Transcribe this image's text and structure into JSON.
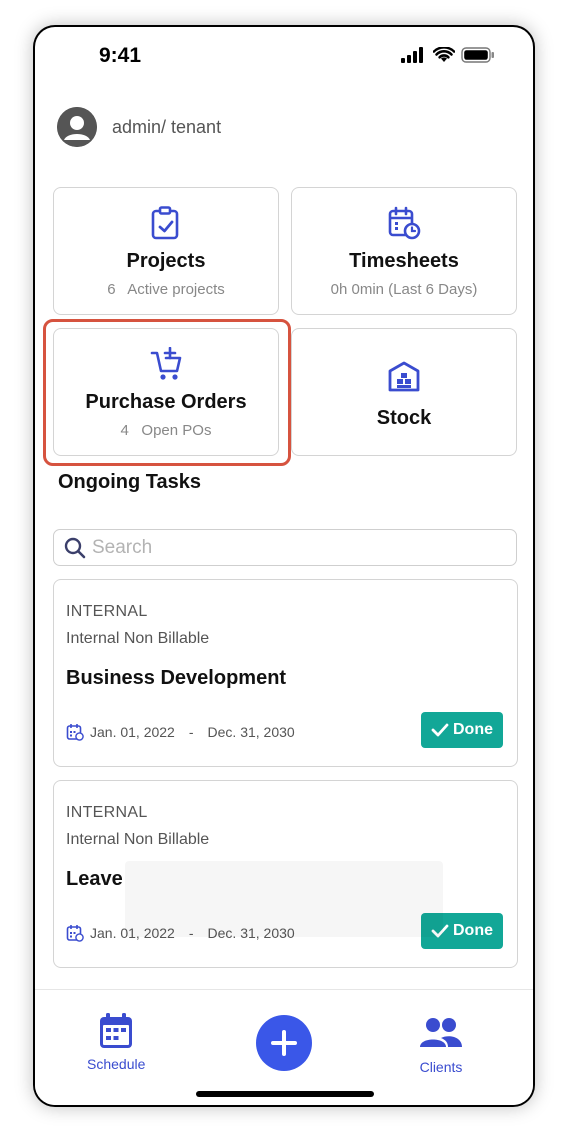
{
  "status_bar": {
    "time": "9:41"
  },
  "header": {
    "user": "admin/ tenant"
  },
  "cards": {
    "projects": {
      "title": "Projects",
      "count": "6",
      "sub": "Active projects"
    },
    "timesheets": {
      "title": "Timesheets",
      "sub": "0h 0min  (Last 6 Days)"
    },
    "purchase_orders": {
      "title": "Purchase Orders",
      "count": "4",
      "sub": "Open POs"
    },
    "stock": {
      "title": "Stock"
    }
  },
  "ongoing": {
    "title": "Ongoing Tasks",
    "search_placeholder": "Search",
    "tasks": [
      {
        "type": "INTERNAL",
        "billing": "Internal Non Billable",
        "name": "Business Development",
        "start": "Jan. 01, 2022",
        "sep": "-",
        "end": "Dec. 31, 2030",
        "status": "Done"
      },
      {
        "type": "INTERNAL",
        "billing": "Internal Non Billable",
        "name": "Leave",
        "start": "Jan. 01, 2022",
        "sep": "-",
        "end": "Dec. 31, 2030",
        "status": "Done"
      }
    ]
  },
  "bottom_nav": {
    "schedule": "Schedule",
    "clients": "Clients"
  },
  "colors": {
    "accent": "#3a4ccf",
    "done": "#12a797",
    "highlight": "#d6533f"
  },
  "icons": [
    "clipboard-check-icon",
    "calendar-clock-icon",
    "cart-plus-icon",
    "warehouse-icon",
    "search-icon",
    "calendar-icon",
    "check-icon",
    "plus-icon",
    "users-icon",
    "avatar-icon"
  ]
}
